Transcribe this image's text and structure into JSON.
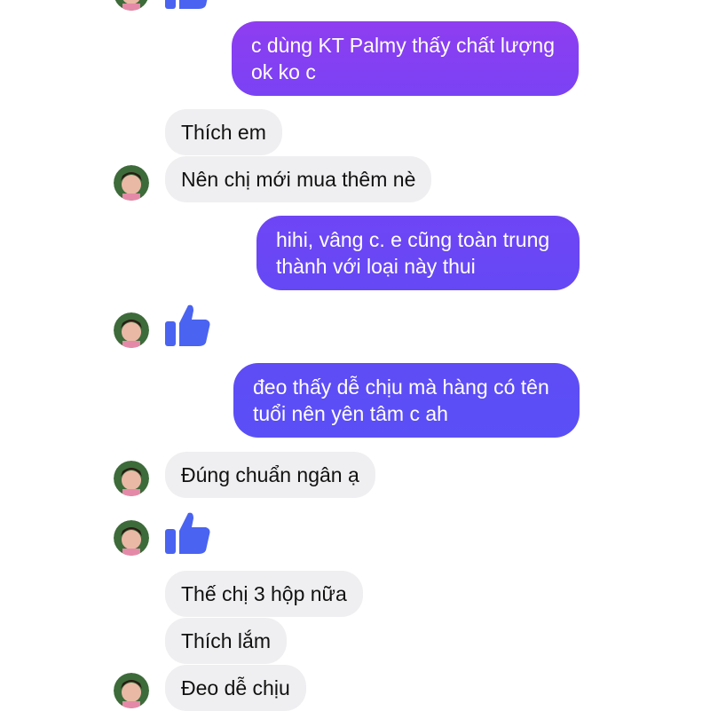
{
  "colors": {
    "incoming_bubble": "#efeff1",
    "outgoing_purple": "#8f3df0",
    "outgoing_violet": "#6548f5",
    "outgoing_blue": "#5a4ff6",
    "thumb_blue": "#4a63f0"
  },
  "messages": {
    "m1": "c dùng KT Palmy thấy chất lượng ok ko c",
    "m2": "Thích em",
    "m3": "Nên chị mới mua thêm nè",
    "m4": "hihi, vâng c. e cũng toàn trung thành với loại này thui",
    "m5": "đeo thấy dễ chịu mà hàng có tên tuổi nên yên tâm c ah",
    "m6": "Đúng chuẩn ngân ạ",
    "m7": "Thế chị 3 hộp nữa",
    "m8": "Thích lắm",
    "m9": "Đeo dễ chịu"
  },
  "icons": {
    "reaction": "thumbs-up-icon",
    "contact": "avatar"
  }
}
